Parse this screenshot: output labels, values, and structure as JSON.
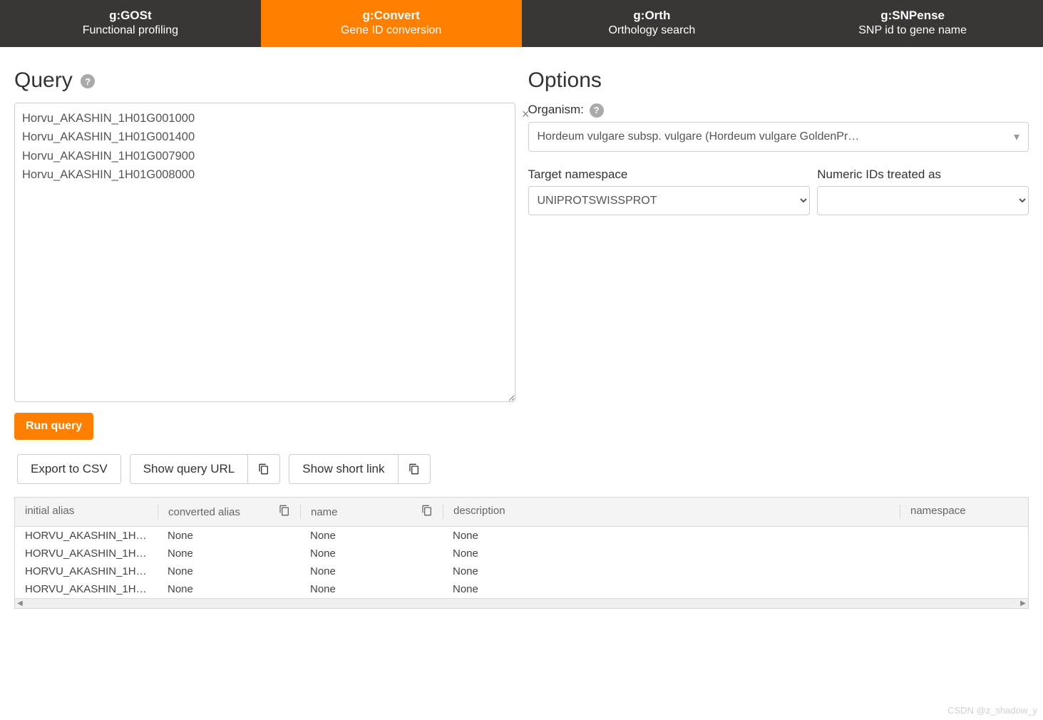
{
  "tabs": [
    {
      "title": "g:GOSt",
      "subtitle": "Functional profiling"
    },
    {
      "title": "g:Convert",
      "subtitle": "Gene ID conversion"
    },
    {
      "title": "g:Orth",
      "subtitle": "Orthology search"
    },
    {
      "title": "g:SNPense",
      "subtitle": "SNP id to gene name"
    }
  ],
  "active_tab_index": 1,
  "query": {
    "heading": "Query",
    "textarea_value": "Horvu_AKASHIN_1H01G001000\nHorvu_AKASHIN_1H01G001400\nHorvu_AKASHIN_1H01G007900\nHorvu_AKASHIN_1H01G008000",
    "clear_icon": "×",
    "run_button": "Run query"
  },
  "options": {
    "heading": "Options",
    "organism_label": "Organism:",
    "organism_value": "Hordeum vulgare subsp. vulgare (Hordeum vulgare GoldenPr…",
    "target_namespace_label": "Target namespace",
    "target_namespace_value": "UNIPROTSWISSPROT",
    "numeric_ids_label": "Numeric IDs treated as",
    "numeric_ids_value": ""
  },
  "export": {
    "csv": "Export to CSV",
    "query_url": "Show query URL",
    "short_link": "Show short link"
  },
  "results": {
    "columns": [
      "initial alias",
      "converted alias",
      "name",
      "description",
      "namespace"
    ],
    "rows": [
      {
        "initial_alias": "HORVU_AKASHIN_1H…",
        "converted_alias": "None",
        "name": "None",
        "description": "None",
        "namespace": ""
      },
      {
        "initial_alias": "HORVU_AKASHIN_1H…",
        "converted_alias": "None",
        "name": "None",
        "description": "None",
        "namespace": ""
      },
      {
        "initial_alias": "HORVU_AKASHIN_1H…",
        "converted_alias": "None",
        "name": "None",
        "description": "None",
        "namespace": ""
      },
      {
        "initial_alias": "HORVU_AKASHIN_1H…",
        "converted_alias": "None",
        "name": "None",
        "description": "None",
        "namespace": ""
      }
    ]
  },
  "watermark": "CSDN @z_shadow_y"
}
